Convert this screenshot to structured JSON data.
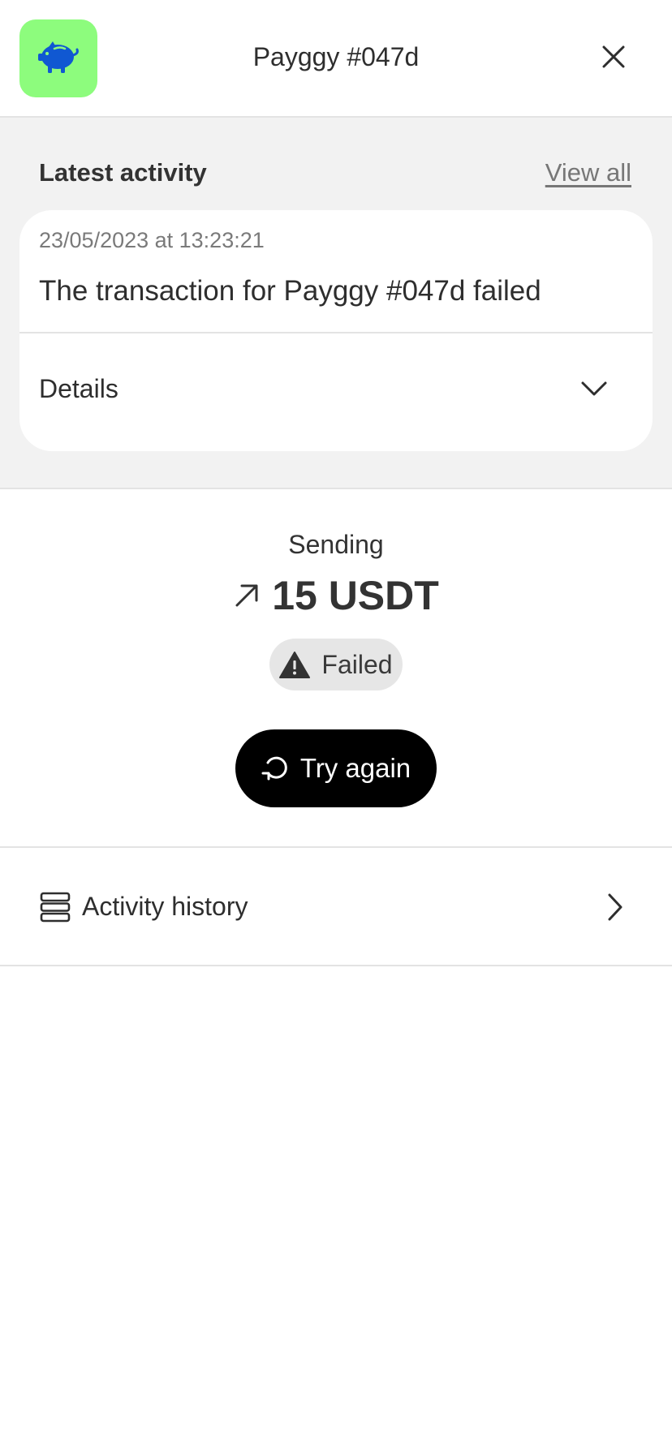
{
  "header": {
    "title": "Payggy #047d",
    "app_icon": "piggy-bank-icon",
    "close_icon": "close-icon"
  },
  "latest_activity": {
    "title": "Latest activity",
    "view_all_label": "View all",
    "card": {
      "timestamp": "23/05/2023 at 13:23:21",
      "message": "The transaction for Payggy #047d failed",
      "details_label": "Details"
    }
  },
  "transaction": {
    "direction": "Sending",
    "amount": "15 USDT",
    "status": "Failed",
    "retry_label": "Try again"
  },
  "activity_history": {
    "label": "Activity history"
  },
  "colors": {
    "app_icon_bg": "#8dfc7d",
    "app_icon_fg": "#1058d2",
    "section_bg": "#f2f2f2",
    "badge_bg": "#e6e6e6",
    "button_bg": "#000000"
  }
}
